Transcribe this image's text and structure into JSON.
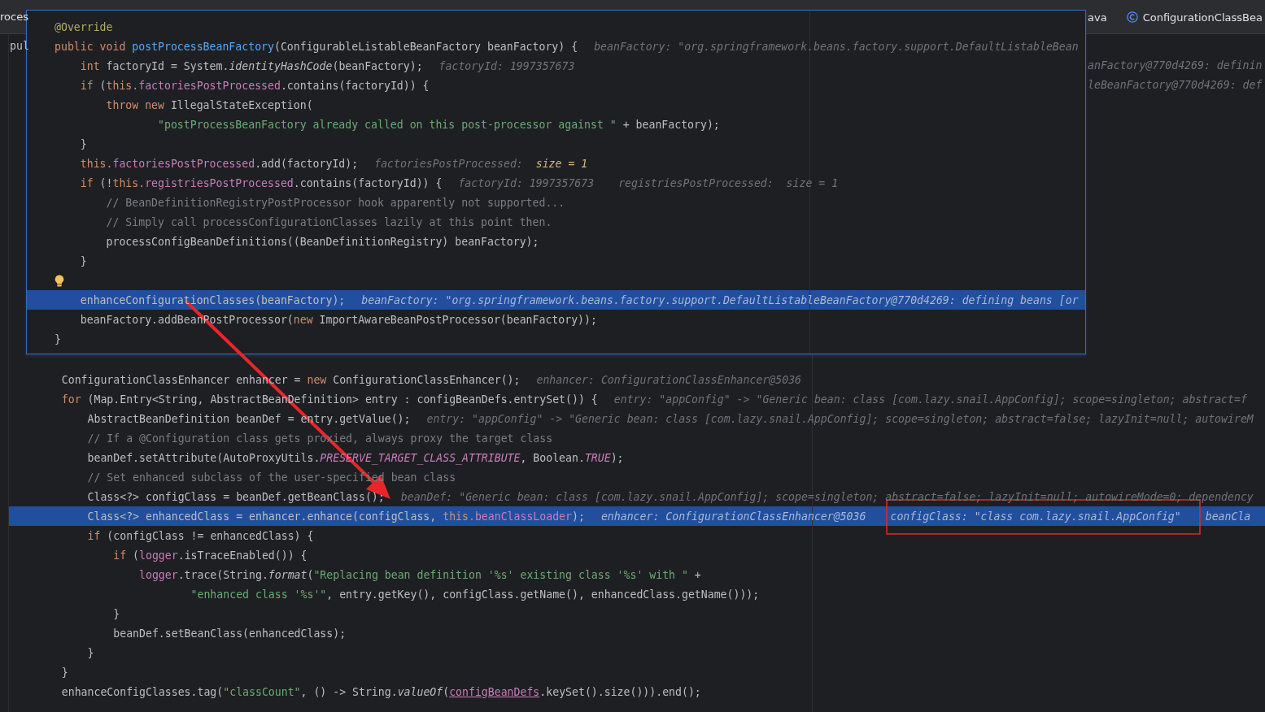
{
  "tabs": [
    {
      "kind": "text",
      "label": "roces",
      "selected": false
    },
    {
      "kind": "text",
      "label": "ava",
      "selected": false
    },
    {
      "kind": "class",
      "label": "ConfigurationClassBea",
      "selected": false
    }
  ],
  "editor": {
    "behind_popup": [
      {
        "kind": "left",
        "text": "pul"
      },
      {
        "kind": "right",
        "text": "anFactory@770d4269: definin"
      },
      {
        "kind": "right",
        "text": "leBeanFactory@770d4269: def"
      }
    ],
    "lines": [
      {
        "highlighted": false,
        "tokens": [
          {
            "kind": "plain",
            "text": "    ConfigurationClassEnhancer enhancer = "
          },
          {
            "kind": "keyword",
            "text": "new "
          },
          {
            "kind": "plain",
            "text": "ConfigurationClassEnhancer();"
          }
        ],
        "hints": [
          [
            {
              "kind": "label",
              "text": "enhancer: ConfigurationClassEnhancer@5036"
            }
          ]
        ]
      },
      {
        "highlighted": false,
        "tokens": [
          {
            "kind": "keyword",
            "text": "    for "
          },
          {
            "kind": "plain",
            "text": "(Map.Entry<String, AbstractBeanDefinition> entry : configBeanDefs.entrySet()) {"
          }
        ],
        "hints": [
          [
            {
              "kind": "label",
              "text": "entry: \"appConfig\" -> \"Generic bean: class [com.lazy.snail.AppConfig]; scope=singleton; abstract=f"
            }
          ]
        ]
      },
      {
        "highlighted": false,
        "tokens": [
          {
            "kind": "plain",
            "text": "        AbstractBeanDefinition beanDef = entry.getValue();"
          }
        ],
        "hints": [
          [
            {
              "kind": "label",
              "text": "entry: \"appConfig\" -> \"Generic bean: class [com.lazy.snail.AppConfig]; scope=singleton; abstract=false; lazyInit=null; autowireM"
            }
          ]
        ]
      },
      {
        "highlighted": false,
        "tokens": [
          {
            "kind": "comment",
            "text": "        // If a @Configuration class gets proxied, always proxy the target class"
          }
        ]
      },
      {
        "highlighted": false,
        "tokens": [
          {
            "kind": "plain",
            "text": "        beanDef.setAttribute(AutoProxyUtils."
          },
          {
            "kind": "constant",
            "text": "PRESERVE_TARGET_CLASS_ATTRIBUTE"
          },
          {
            "kind": "plain",
            "text": ", Boolean."
          },
          {
            "kind": "constant",
            "text": "TRUE"
          },
          {
            "kind": "plain",
            "text": ");"
          }
        ]
      },
      {
        "highlighted": false,
        "tokens": [
          {
            "kind": "comment",
            "text": "        // Set enhanced subclass of the user-specified bean class"
          }
        ]
      },
      {
        "highlighted": false,
        "tokens": [
          {
            "kind": "plain",
            "text": "        Class<?> configClass = beanDef.getBeanClass();"
          }
        ],
        "hints": [
          [
            {
              "kind": "label",
              "text": "beanDef: \"Generic bean: class [com.lazy.snail.AppConfig]; scope=singleton; abstract=false; lazyInit=null; autowireMode=0; dependency"
            }
          ]
        ]
      },
      {
        "highlighted": true,
        "tokens": [
          {
            "kind": "plain",
            "text": "        Class<?> enhancedClass = enhancer.enhance(configClass, "
          },
          {
            "kind": "keyword",
            "text": "this"
          },
          {
            "kind": "field",
            "text": ".beanClassLoader"
          },
          {
            "kind": "plain",
            "text": ");"
          }
        ],
        "hints": [
          [
            {
              "kind": "label",
              "text": "enhancer: ConfigurationClassEnhancer@5036"
            }
          ],
          [
            {
              "kind": "label",
              "text": "configClass: \"class com.lazy.snail.AppConfig\""
            }
          ],
          [
            {
              "kind": "label",
              "text": "beanCla"
            }
          ]
        ]
      },
      {
        "highlighted": false,
        "tokens": [
          {
            "kind": "keyword",
            "text": "        if "
          },
          {
            "kind": "plain",
            "text": "(configClass != enhancedClass) {"
          }
        ]
      },
      {
        "highlighted": false,
        "tokens": [
          {
            "kind": "keyword",
            "text": "            if "
          },
          {
            "kind": "plain",
            "text": "("
          },
          {
            "kind": "field",
            "text": "logger"
          },
          {
            "kind": "plain",
            "text": ".isTraceEnabled()) {"
          }
        ]
      },
      {
        "highlighted": false,
        "tokens": [
          {
            "kind": "field",
            "text": "                logger"
          },
          {
            "kind": "plain",
            "text": ".trace(String."
          },
          {
            "kind": "static",
            "text": "format"
          },
          {
            "kind": "plain",
            "text": "("
          },
          {
            "kind": "string",
            "text": "\"Replacing bean definition '%s' existing class '%s' with \""
          },
          {
            "kind": "plain",
            "text": " +"
          }
        ]
      },
      {
        "highlighted": false,
        "tokens": [
          {
            "kind": "string",
            "text": "                        \"enhanced class '%s'\""
          },
          {
            "kind": "plain",
            "text": ", entry.getKey(), configClass.getName(), enhancedClass.getName()));"
          }
        ]
      },
      {
        "highlighted": false,
        "tokens": [
          {
            "kind": "plain",
            "text": "            }"
          }
        ]
      },
      {
        "highlighted": false,
        "tokens": [
          {
            "kind": "plain",
            "text": "            beanDef.setBeanClass(enhancedClass);"
          }
        ]
      },
      {
        "highlighted": false,
        "tokens": [
          {
            "kind": "plain",
            "text": "        }"
          }
        ]
      },
      {
        "highlighted": false,
        "tokens": [
          {
            "kind": "plain",
            "text": "    }"
          }
        ]
      },
      {
        "highlighted": false,
        "tokens": [
          {
            "kind": "plain",
            "text": "    enhanceConfigClasses.tag("
          },
          {
            "kind": "string",
            "text": "\"classCount\""
          },
          {
            "kind": "plain",
            "text": ", () -> String."
          },
          {
            "kind": "static",
            "text": "valueOf"
          },
          {
            "kind": "plain",
            "text": "("
          },
          {
            "kind": "link",
            "text": "configBeanDefs"
          },
          {
            "kind": "plain",
            "text": ".keySet().size())).end();"
          }
        ]
      }
    ]
  },
  "popup": {
    "lines": [
      {
        "kind": "code",
        "highlighted": false,
        "tokens": [
          {
            "kind": "annotation",
            "text": "@Override"
          }
        ]
      },
      {
        "kind": "code",
        "highlighted": false,
        "tokens": [
          {
            "kind": "keyword",
            "text": "public void "
          },
          {
            "kind": "declaration",
            "text": "postProcessBeanFactory"
          },
          {
            "kind": "plain",
            "text": "(ConfigurableListableBeanFactory beanFactory) {"
          }
        ],
        "hints": [
          [
            {
              "kind": "label",
              "text": "beanFactory: \"org.springframework.beans.factory.support.DefaultListableBean"
            }
          ]
        ]
      },
      {
        "kind": "code",
        "highlighted": false,
        "tokens": [
          {
            "kind": "keyword",
            "text": "    int "
          },
          {
            "kind": "plain",
            "text": "factoryId = System."
          },
          {
            "kind": "static",
            "text": "identityHashCode"
          },
          {
            "kind": "plain",
            "text": "(beanFactory);"
          }
        ],
        "hints": [
          [
            {
              "kind": "label",
              "text": "factoryId: 1997357673"
            }
          ]
        ]
      },
      {
        "kind": "code",
        "highlighted": false,
        "tokens": [
          {
            "kind": "keyword",
            "text": "    if "
          },
          {
            "kind": "plain",
            "text": "("
          },
          {
            "kind": "keyword",
            "text": "this"
          },
          {
            "kind": "field",
            "text": ".factoriesPostProcessed"
          },
          {
            "kind": "plain",
            "text": ".contains(factoryId)) {"
          }
        ]
      },
      {
        "kind": "code",
        "highlighted": false,
        "tokens": [
          {
            "kind": "keyword",
            "text": "        throw new "
          },
          {
            "kind": "plain",
            "text": "IllegalStateException("
          }
        ]
      },
      {
        "kind": "code",
        "highlighted": false,
        "tokens": [
          {
            "kind": "string",
            "text": "                \"postProcessBeanFactory already called on this post-processor against \""
          },
          {
            "kind": "plain",
            "text": " + beanFactory);"
          }
        ]
      },
      {
        "kind": "code",
        "highlighted": false,
        "tokens": [
          {
            "kind": "plain",
            "text": "    }"
          }
        ]
      },
      {
        "kind": "code",
        "highlighted": false,
        "tokens": [
          {
            "kind": "keyword",
            "text": "    this"
          },
          {
            "kind": "field",
            "text": ".factoriesPostProcessed"
          },
          {
            "kind": "plain",
            "text": ".add(factoryId);"
          }
        ],
        "hints": [
          [
            {
              "kind": "label",
              "text": "factoriesPostProcessed:  "
            },
            {
              "kind": "value",
              "text": "size = 1"
            }
          ]
        ]
      },
      {
        "kind": "code",
        "highlighted": false,
        "tokens": [
          {
            "kind": "keyword",
            "text": "    if "
          },
          {
            "kind": "plain",
            "text": "(!"
          },
          {
            "kind": "keyword",
            "text": "this"
          },
          {
            "kind": "field",
            "text": ".registriesPostProcessed"
          },
          {
            "kind": "plain",
            "text": ".contains(factoryId)) {"
          }
        ],
        "hints": [
          [
            {
              "kind": "label",
              "text": "factoryId: 1997357673"
            }
          ],
          [
            {
              "kind": "label",
              "text": "registriesPostProcessed:  size = 1"
            }
          ]
        ]
      },
      {
        "kind": "code",
        "highlighted": false,
        "tokens": [
          {
            "kind": "comment",
            "text": "        // BeanDefinitionRegistryPostProcessor hook apparently not supported..."
          }
        ]
      },
      {
        "kind": "code",
        "highlighted": false,
        "tokens": [
          {
            "kind": "comment",
            "text": "        // Simply call processConfigurationClasses lazily at this point then."
          }
        ]
      },
      {
        "kind": "code",
        "highlighted": false,
        "tokens": [
          {
            "kind": "plain",
            "text": "        processConfigBeanDefinitions((BeanDefinitionRegistry) beanFactory);"
          }
        ]
      },
      {
        "kind": "code",
        "highlighted": false,
        "tokens": [
          {
            "kind": "plain",
            "text": "    }"
          }
        ]
      },
      {
        "kind": "bulb",
        "highlighted": false
      },
      {
        "kind": "code",
        "highlighted": true,
        "tokens": [
          {
            "kind": "plain",
            "text": "    enhanceConfigurationClasses(beanFactory);"
          }
        ],
        "hints": [
          [
            {
              "kind": "label",
              "text": "beanFactory: \"org.springframework.beans.factory.support.DefaultListableBeanFactory@770d4269: defining beans [or"
            }
          ]
        ]
      },
      {
        "kind": "code",
        "highlighted": false,
        "tokens": [
          {
            "kind": "plain",
            "text": "    beanFactory.addBeanPostProcessor("
          },
          {
            "kind": "keyword",
            "text": "new "
          },
          {
            "kind": "plain",
            "text": "ImportAwareBeanPostProcessor(beanFactory));"
          }
        ]
      },
      {
        "kind": "code",
        "highlighted": false,
        "tokens": [
          {
            "kind": "plain",
            "text": "}"
          }
        ]
      }
    ]
  }
}
